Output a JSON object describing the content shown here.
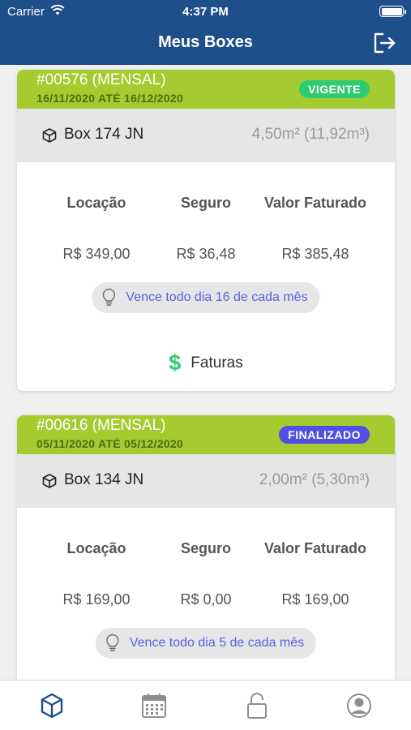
{
  "status_bar": {
    "carrier": "Carrier",
    "time": "4:37 PM"
  },
  "nav": {
    "title": "Meus Boxes",
    "logout_icon": "logout-icon"
  },
  "contracts": [
    {
      "code": "#00576 (MENSAL)",
      "period": "16/11/2020 ATÉ 16/12/2020",
      "status": "VIGENTE",
      "status_color": "#2ecc71",
      "box_name": "Box 174 JN",
      "box_size": "4,50m² (11,92m³)",
      "columns": [
        {
          "label": "Locação",
          "value": "R$ 349,00"
        },
        {
          "label": "Seguro",
          "value": "R$ 36,48"
        },
        {
          "label": "Valor Faturado",
          "value": "R$ 385,48"
        }
      ],
      "due_text": "Vence todo dia 16 de cada mês",
      "invoices_label": "Faturas",
      "invoices_symbol": "$"
    },
    {
      "code": "#00616 (MENSAL)",
      "period": "05/11/2020 ATÉ 05/12/2020",
      "status": "FINALIZADO",
      "status_color": "#5050e6",
      "box_name": "Box 134 JN",
      "box_size": "2,00m² (5,30m³)",
      "columns": [
        {
          "label": "Locação",
          "value": "R$ 169,00"
        },
        {
          "label": "Seguro",
          "value": "R$ 0,00"
        },
        {
          "label": "Valor Faturado",
          "value": "R$ 169,00"
        }
      ],
      "due_text": "Vence todo dia 5 de cada mês"
    }
  ],
  "tab_bar": [
    {
      "icon": "box-icon",
      "active": true
    },
    {
      "icon": "calendar-icon",
      "active": false
    },
    {
      "icon": "unlock-icon",
      "active": false
    },
    {
      "icon": "profile-icon",
      "active": false
    }
  ],
  "colors": {
    "nav_bg": "#1f4f8b",
    "card_header": "#a4cb2f",
    "link": "#5b5fe0",
    "active_tab": "#1f4f8b",
    "inactive_tab": "#8e8e8e"
  }
}
